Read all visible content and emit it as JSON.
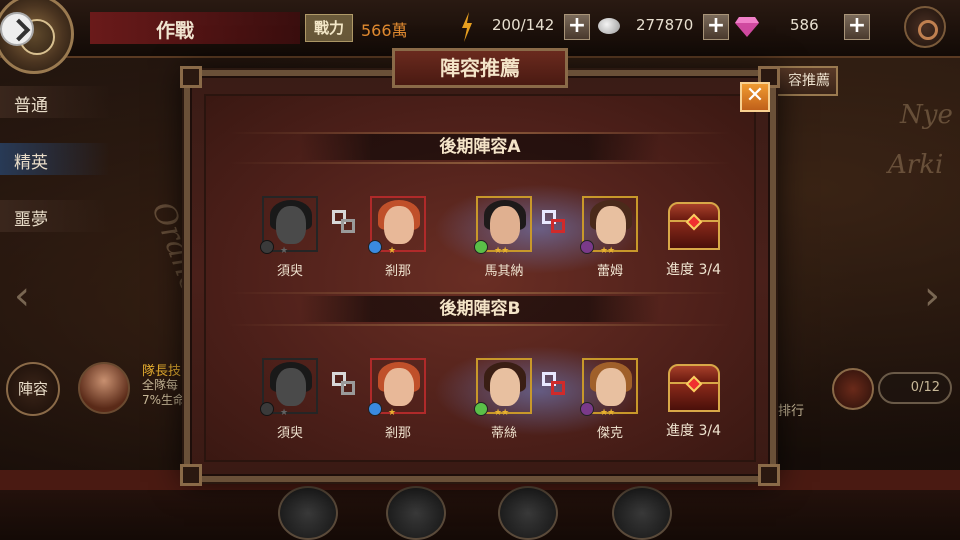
{
  "topbar": {
    "title": "作戰",
    "power_label": "戰力",
    "power_value": "566萬",
    "stamina": "200/142",
    "coins": "277870",
    "gems": "586",
    "plus": "+"
  },
  "sidebar": {
    "tabs": [
      {
        "label": "普通"
      },
      {
        "label": "精英"
      },
      {
        "label": "噩夢"
      }
    ],
    "lineup_label": "陣容",
    "captain_lines": [
      "隊長技",
      "全隊每",
      "7%生命"
    ]
  },
  "right": {
    "recommend_label": "容推薦",
    "rank_label": "排行",
    "progress_pill": "0/12"
  },
  "map_words": {
    "left": "Orane",
    "right1": "Nye",
    "right2": "Arki"
  },
  "modal": {
    "title": "陣容推薦",
    "close": "✕",
    "sections": [
      {
        "title": "後期陣容A",
        "members": [
          {
            "name": "須臾",
            "element_color": "#6a6a6a",
            "stars": "★",
            "style": "grey",
            "skin": "#a08070",
            "hair": "#3a2a20"
          },
          {
            "name": "剎那",
            "element_color": "#3a8ae0",
            "stars": "★",
            "style": "red",
            "skin": "#e8b898",
            "hair": "#c0502a"
          },
          {
            "name": "馬其納",
            "element_color": "#5ac048",
            "stars": "★★",
            "style": "gold",
            "skin": "#e0b090",
            "hair": "#1e1a1a"
          },
          {
            "name": "蕾姆",
            "element_color": "#7a3a8a",
            "stars": "★★",
            "style": "gold",
            "skin": "#e8c0a0",
            "hair": "#4a2a1a"
          }
        ],
        "progress": "進度 3/4"
      },
      {
        "title": "後期陣容B",
        "members": [
          {
            "name": "須臾",
            "element_color": "#6a6a6a",
            "stars": "★",
            "style": "grey",
            "skin": "#a08070",
            "hair": "#3a2a20"
          },
          {
            "name": "剎那",
            "element_color": "#3a8ae0",
            "stars": "★",
            "style": "red",
            "skin": "#e8b898",
            "hair": "#c0502a"
          },
          {
            "name": "蒂絲",
            "element_color": "#5ac048",
            "stars": "★★",
            "style": "gold",
            "skin": "#e8c0a0",
            "hair": "#3a1e14"
          },
          {
            "name": "傑克",
            "element_color": "#7a3a8a",
            "stars": "★★",
            "style": "gold",
            "skin": "#e8c0a0",
            "hair": "#a0602a"
          }
        ],
        "progress": "進度 3/4"
      }
    ]
  }
}
